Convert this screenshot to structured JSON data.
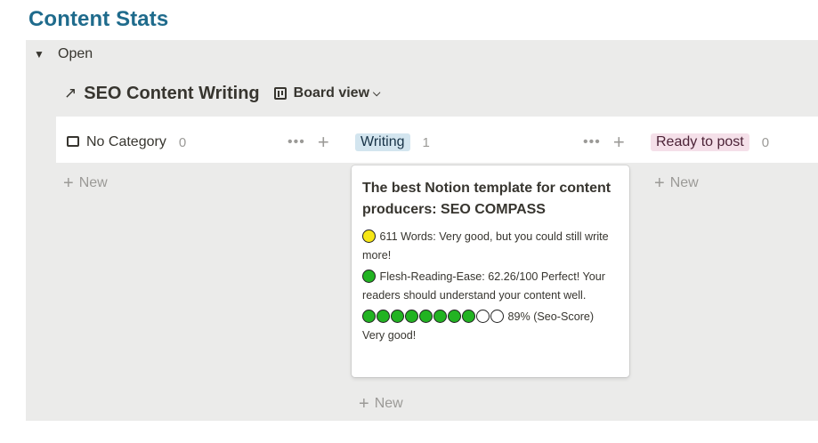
{
  "page": {
    "title": "Content Stats"
  },
  "group": {
    "label": "Open"
  },
  "database": {
    "title": "SEO Content Writing",
    "view_label": "Board view"
  },
  "columns": [
    {
      "label": "No Category",
      "count": "0",
      "new_label": "New"
    },
    {
      "label": "Writing",
      "count": "1",
      "new_label": "New",
      "tag_color": "#d3e5ef"
    },
    {
      "label": "Ready to post",
      "count": "0",
      "new_label": "New",
      "tag_color": "#f5e0e9"
    }
  ],
  "card": {
    "title": "The best Notion template for content producers: SEO COMPASS",
    "words": {
      "indicator": "yellow",
      "text": "611 Words:  Very good, but you could still write more!"
    },
    "reading": {
      "indicator": "green",
      "text": "Flesh-Reading-Ease: 62.26/100  Perfect! Your readers should understand your content well."
    },
    "seo_score": {
      "filled": 8,
      "total": 10,
      "text": "89% (Seo-Score) Very good!"
    }
  },
  "colors": {
    "title": "#1f6b8c",
    "indicator_yellow": "#f6e716",
    "indicator_green": "#22b322"
  }
}
